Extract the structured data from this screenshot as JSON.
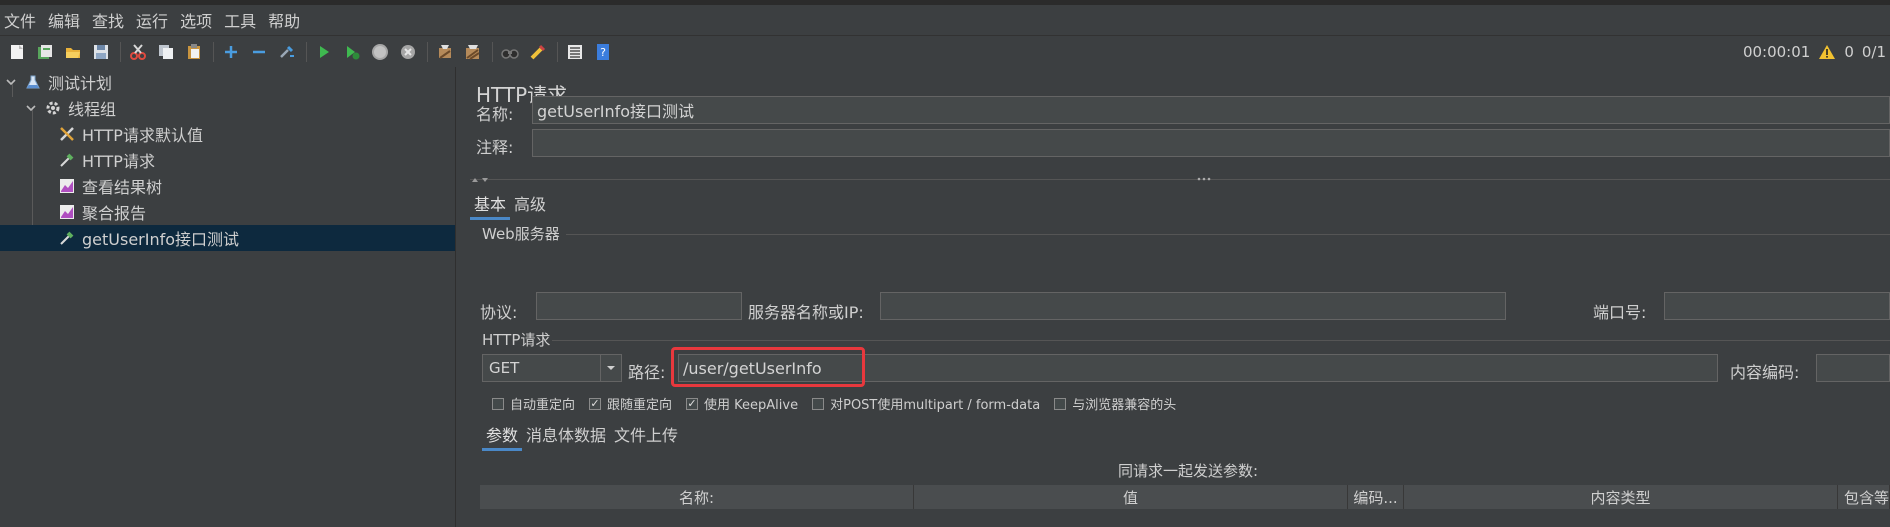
{
  "menu": [
    "文件",
    "编辑",
    "查找",
    "运行",
    "选项",
    "工具",
    "帮助"
  ],
  "toolbar": {
    "icons": [
      "new-icon",
      "templates-icon",
      "open-icon",
      "save-icon",
      "cut-icon",
      "copy-icon",
      "paste-icon",
      "expand-icon",
      "collapse-icon",
      "toggle-icon",
      "start-icon",
      "start-no-pause-icon",
      "stop-icon",
      "shutdown-icon",
      "clear-icon",
      "clear-all-icon",
      "search-icon",
      "reset-search-icon",
      "function-helper-icon",
      "help-icon"
    ],
    "timer": "00:00:01",
    "warnings": "0",
    "threads": "0/1"
  },
  "tree": [
    {
      "label": "测试计划",
      "icon": "test-plan-icon",
      "level": 0,
      "expanded": true
    },
    {
      "label": "线程组",
      "icon": "thread-group-icon",
      "level": 1,
      "expanded": true
    },
    {
      "label": "HTTP请求默认值",
      "icon": "config-tools-icon",
      "level": 2
    },
    {
      "label": "HTTP请求",
      "icon": "sampler-pipette-icon",
      "level": 2
    },
    {
      "label": "查看结果树",
      "icon": "listener-graph-icon",
      "level": 2
    },
    {
      "label": "聚合报告",
      "icon": "listener-graph-icon",
      "level": 2
    },
    {
      "label": "getUserInfo接口测试",
      "icon": "sampler-pipette-icon",
      "level": 2,
      "selected": true
    }
  ],
  "panel": {
    "title": "HTTP请求",
    "name_label": "名称:",
    "name_value": "getUserInfo接口测试",
    "comment_label": "注释:",
    "comment_value": "",
    "tabs": [
      "基本",
      "高级"
    ],
    "web_server": {
      "title": "Web服务器",
      "protocol_label": "协议:",
      "protocol_value": "",
      "server_label": "服务器名称或IP:",
      "server_value": "",
      "port_label": "端口号:",
      "port_value": ""
    },
    "http_request": {
      "title": "HTTP请求",
      "method": "GET",
      "path_label": "路径:",
      "path_value": "/user/getUserInfo",
      "encoding_label": "内容编码:",
      "encoding_value": ""
    },
    "options": [
      {
        "label": "自动重定向",
        "checked": false
      },
      {
        "label": "跟随重定向",
        "checked": true
      },
      {
        "label": "使用 KeepAlive",
        "checked": true
      },
      {
        "label": "对POST使用multipart / form-data",
        "checked": false
      },
      {
        "label": "与浏览器兼容的头",
        "checked": false
      }
    ],
    "sub_tabs": [
      "参数",
      "消息体数据",
      "文件上传"
    ],
    "params_caption": "同请求一起发送参数:",
    "columns": [
      "名称:",
      "值",
      "编码...",
      "内容类型",
      "包含等"
    ]
  },
  "colors": {
    "background": "#3c3f41",
    "selected_row": "#0d293e",
    "highlight": "#e8383d",
    "tab_accent": "#4a88c7"
  }
}
